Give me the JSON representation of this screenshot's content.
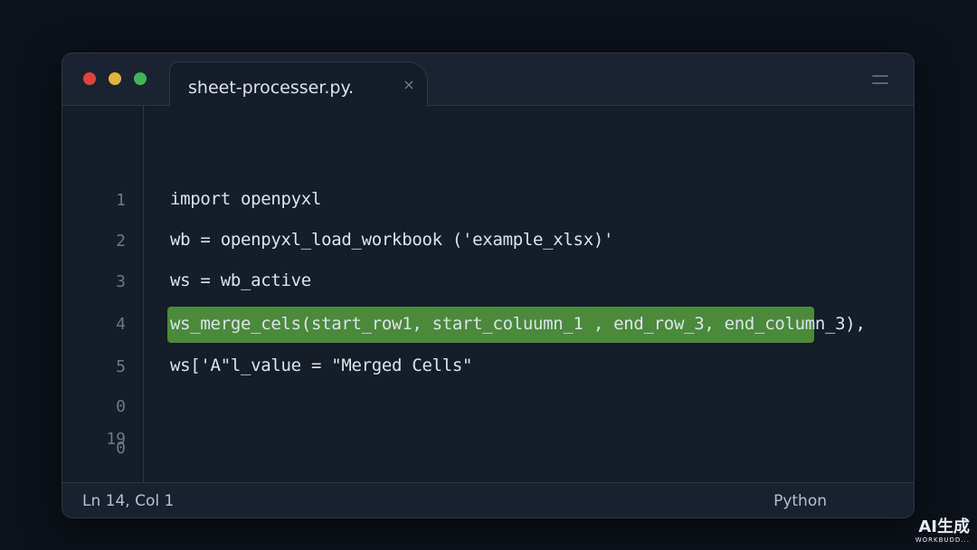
{
  "window": {
    "tab_label": "sheet-processer.py.",
    "tab_close": "×"
  },
  "gutter": {
    "line_numbers": [
      "1",
      "2",
      "3",
      "4",
      "5",
      "0",
      "0",
      "19"
    ]
  },
  "code": {
    "lines": [
      "import openpyxl",
      "wb = openpyxl_load_workbook ('example_xlsx)'",
      "ws = wb_active",
      "ws_merge_cels(start_row1, start_coluumn_1 , end_row_3, end_column_3),",
      "ws['A\"l_value = \"Merged Cells\""
    ],
    "highlighted_line": 4,
    "highlight_color": "#4b8a3a"
  },
  "statusbar": {
    "position": "Ln 14, Col 1",
    "language": "Python"
  },
  "watermark": {
    "main": "AI生成",
    "sub": "WORKBUDD..."
  },
  "colors": {
    "background": "#0c121a",
    "editor": "#141d28",
    "text": "#dce3eb",
    "close_dot": "#e0443e",
    "minimize_dot": "#e3b23c",
    "maximize_dot": "#3fb55a"
  },
  "icons": {
    "close": "close-icon",
    "menu": "hamburger-menu-icon"
  }
}
